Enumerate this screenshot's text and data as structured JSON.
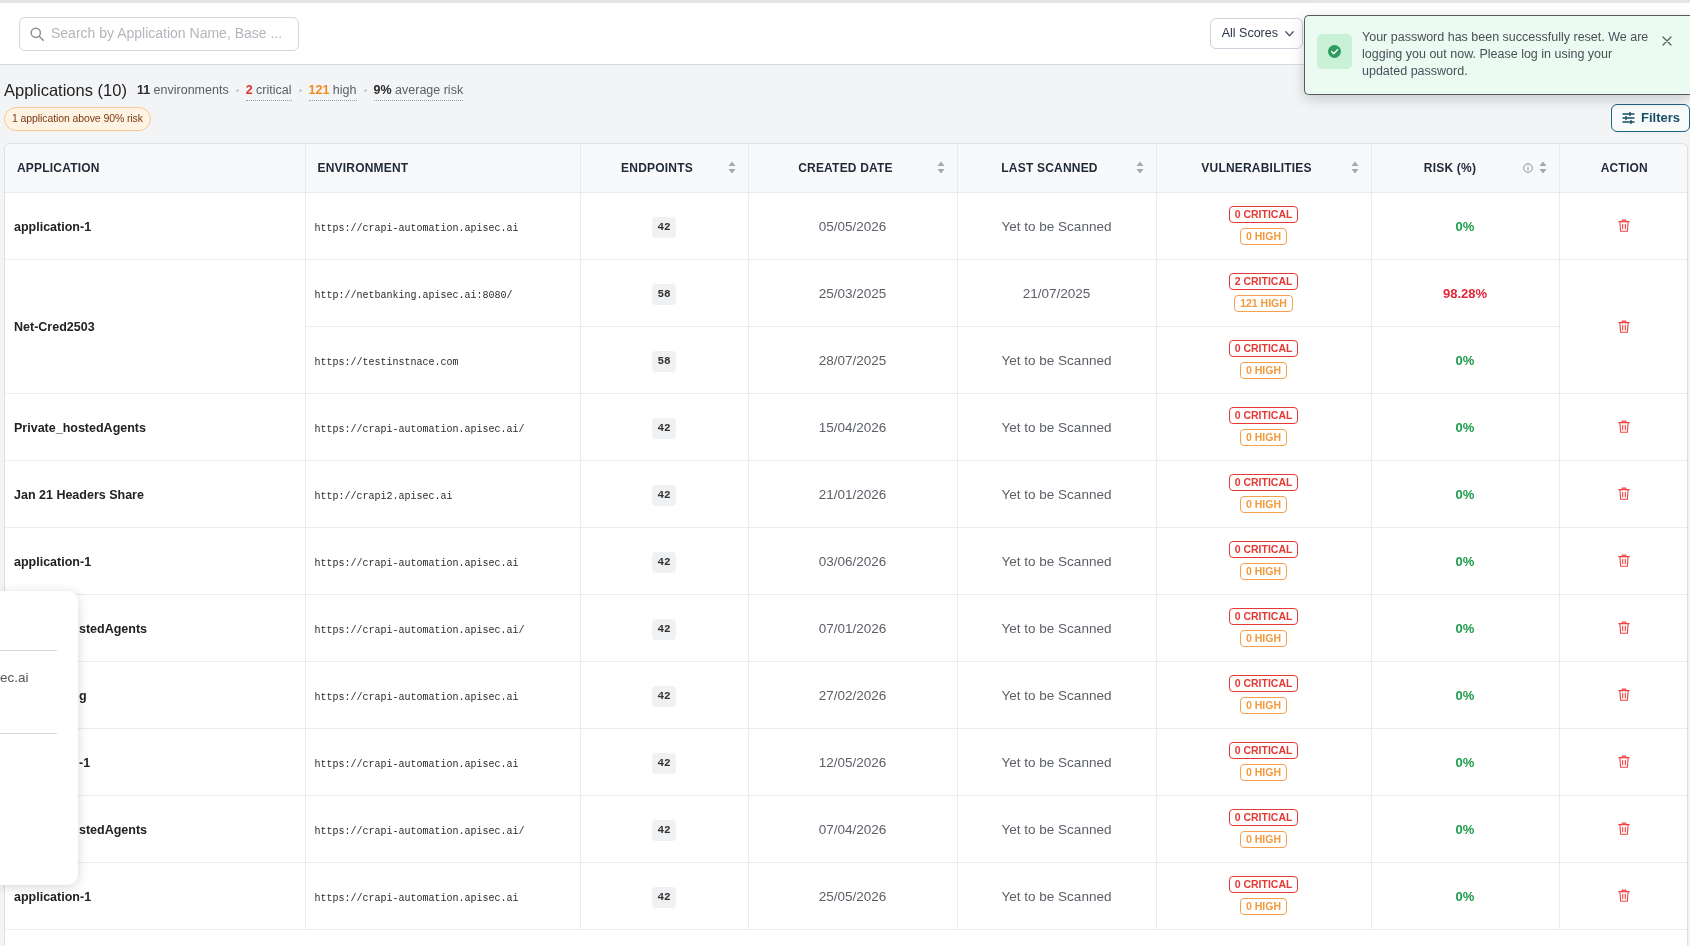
{
  "search": {
    "placeholder": "Search by Application Name, Base ..."
  },
  "score_filter": {
    "value": "All Scores"
  },
  "toast": {
    "message": "Your password has been successfully reset. We are logging you out now. Please log in using your updated password."
  },
  "header": {
    "title": "Applications (10)",
    "stats": [
      {
        "figure": "11",
        "text": "environments",
        "color": "#2b2b2b",
        "underlined": false
      },
      {
        "figure": "2",
        "text": "critical",
        "color": "#e0322f",
        "underlined": true
      },
      {
        "figure": "121",
        "text": "high",
        "color": "#f28a1c",
        "underlined": true
      },
      {
        "figure": "9%",
        "text": "average risk",
        "color": "#2b2b2b",
        "underlined": true
      }
    ],
    "alert_badge": "1 application above 90% risk"
  },
  "filters_button": {
    "label": "Filters"
  },
  "table": {
    "columns": [
      {
        "label": "APPLICATION",
        "sortable": false,
        "info": false
      },
      {
        "label": "ENVIRONMENT",
        "sortable": false,
        "info": false
      },
      {
        "label": "ENDPOINTS",
        "sortable": true,
        "info": false
      },
      {
        "label": "CREATED DATE",
        "sortable": true,
        "info": false
      },
      {
        "label": "LAST SCANNED",
        "sortable": true,
        "info": false
      },
      {
        "label": "VULNERABILITIES",
        "sortable": true,
        "info": false
      },
      {
        "label": "RISK (%)",
        "sortable": true,
        "info": true
      },
      {
        "label": "ACTION",
        "sortable": false,
        "info": false
      }
    ],
    "rows": [
      {
        "application": "application-1",
        "environments": [
          {
            "url": "https://crapi-automation.apisec.ai",
            "endpoints": "42",
            "created": "05/05/2026",
            "last_scanned": "Yet to be Scanned",
            "critical": "0 CRITICAL",
            "high": "0 HIGH",
            "risk": "0%",
            "color": "#1f9d4c"
          }
        ]
      },
      {
        "application": "Net-Cred2503",
        "environments": [
          {
            "url": "http://netbanking.apisec.ai:8080/",
            "endpoints": "58",
            "created": "25/03/2025",
            "last_scanned": "21/07/2025",
            "critical": "2 CRITICAL",
            "high": "121 HIGH",
            "risk": "98.28%",
            "color": "#e0283a"
          },
          {
            "url": "https://testinstnace.com",
            "endpoints": "58",
            "created": "28/07/2025",
            "last_scanned": "Yet to be Scanned",
            "critical": "0 CRITICAL",
            "high": "0 HIGH",
            "risk": "0%",
            "color": "#1f9d4c"
          }
        ]
      },
      {
        "application": "Private_hostedAgents",
        "environments": [
          {
            "url": "https://crapi-automation.apisec.ai/",
            "endpoints": "42",
            "created": "15/04/2026",
            "last_scanned": "Yet to be Scanned",
            "critical": "0 CRITICAL",
            "high": "0 HIGH",
            "risk": "0%",
            "color": "#1f9d4c"
          }
        ]
      },
      {
        "application": "Jan 21 Headers Share",
        "environments": [
          {
            "url": "http://crapi2.apisec.ai",
            "endpoints": "42",
            "created": "21/01/2026",
            "last_scanned": "Yet to be Scanned",
            "critical": "0 CRITICAL",
            "high": "0 HIGH",
            "risk": "0%",
            "color": "#1f9d4c"
          }
        ]
      },
      {
        "application": "application-1",
        "environments": [
          {
            "url": "https://crapi-automation.apisec.ai",
            "endpoints": "42",
            "created": "03/06/2026",
            "last_scanned": "Yet to be Scanned",
            "critical": "0 CRITICAL",
            "high": "0 HIGH",
            "risk": "0%",
            "color": "#1f9d4c"
          }
        ]
      },
      {
        "application": "stedAgents",
        "environments": [
          {
            "url": "https://crapi-automation.apisec.ai/",
            "endpoints": "42",
            "created": "07/01/2026",
            "last_scanned": "Yet to be Scanned",
            "critical": "0 CRITICAL",
            "high": "0 HIGH",
            "risk": "0%",
            "color": "#1f9d4c"
          }
        ]
      },
      {
        "application": "g",
        "environments": [
          {
            "url": "https://crapi-automation.apisec.ai",
            "endpoints": "42",
            "created": "27/02/2026",
            "last_scanned": "Yet to be Scanned",
            "critical": "0 CRITICAL",
            "high": "0 HIGH",
            "risk": "0%",
            "color": "#1f9d4c"
          }
        ]
      },
      {
        "application": "-1",
        "environments": [
          {
            "url": "https://crapi-automation.apisec.ai",
            "endpoints": "42",
            "created": "12/05/2026",
            "last_scanned": "Yet to be Scanned",
            "critical": "0 CRITICAL",
            "high": "0 HIGH",
            "risk": "0%",
            "color": "#1f9d4c"
          }
        ]
      },
      {
        "application": "stedAgents",
        "environments": [
          {
            "url": "https://crapi-automation.apisec.ai/",
            "endpoints": "42",
            "created": "07/04/2026",
            "last_scanned": "Yet to be Scanned",
            "critical": "0 CRITICAL",
            "high": "0 HIGH",
            "risk": "0%",
            "color": "#1f9d4c"
          }
        ]
      },
      {
        "application": "application-1",
        "environments": [
          {
            "url": "https://crapi-automation.apisec.ai",
            "endpoints": "42",
            "created": "25/05/2026",
            "last_scanned": "Yet to be Scanned",
            "critical": "0 CRITICAL",
            "high": "0 HIGH",
            "risk": "0%",
            "color": "#1f9d4c"
          }
        ]
      }
    ]
  },
  "popup": {
    "text": "ec.ai"
  }
}
